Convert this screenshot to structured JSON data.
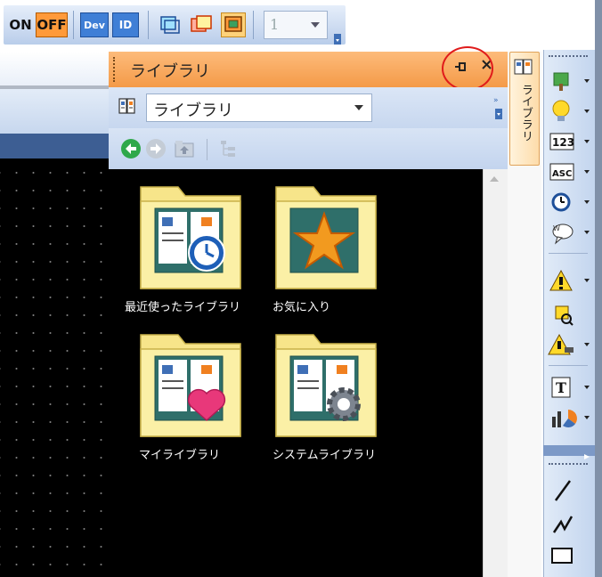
{
  "toolbar": {
    "on_label": "ON",
    "off_label": "OFF",
    "dev_label": "Dev",
    "id_label": "ID",
    "layer_value": "1"
  },
  "library_panel": {
    "title": "ライブラリ",
    "dropdown_value": "ライブラリ",
    "folders": [
      {
        "label": "最近使ったライブラリ",
        "icon": "recent-library-icon"
      },
      {
        "label": "お気に入り",
        "icon": "favorites-icon"
      },
      {
        "label": "マイライブラリ",
        "icon": "my-library-icon"
      },
      {
        "label": "システムライブラリ",
        "icon": "system-library-icon"
      }
    ]
  },
  "side_tab": {
    "label": "ライブラリ"
  },
  "palette": {
    "tools": [
      "paint-icon",
      "lamp-icon",
      "numeric-display-icon",
      "ascii-display-icon",
      "clock-icon",
      "message-icon",
      "alarm-icon",
      "search-device-icon",
      "alert-icon",
      "text-icon",
      "chart-icon",
      "line-icon",
      "polyline-icon",
      "rectangle-icon"
    ],
    "numeric_label": "123",
    "ascii_label": "ASC",
    "text_label": "T"
  },
  "colors": {
    "panel_title": "#f49a48",
    "toolbar_accent": "#ff9a3a",
    "callout": "#e01b1b",
    "folder": "#f7e58a"
  }
}
